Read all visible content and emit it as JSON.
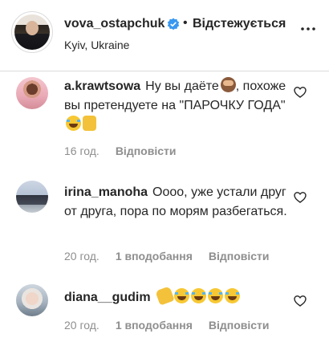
{
  "header": {
    "username": "vova_ostapchuk",
    "separator": "•",
    "follow_status": "Відстежується",
    "location": "Kyiv, Ukraine"
  },
  "comments": [
    {
      "username": "a.krawtsowa",
      "text_parts": [
        "Ну вы даёте",
        ", похоже вы претендуете на \"ПАРОЧКУ ГОДА\""
      ],
      "time": "16 год.",
      "likes": "",
      "reply": "Відповісти"
    },
    {
      "username": "irina_manoha",
      "text": "Оооо, уже устали друг от друга, пора по морям разбегаться.",
      "time": "20 год.",
      "likes": "1 вподобання",
      "reply": "Відповісти"
    },
    {
      "username": "diana__gudim",
      "text": "",
      "time": "20 год.",
      "likes": "1 вподобання",
      "reply": "Відповісти"
    }
  ],
  "icons": {
    "verified": "verified-badge-icon",
    "more": "more-options-icon",
    "heart": "heart-outline-icon"
  },
  "colors": {
    "text": "#262626",
    "secondary": "#8e8e8e",
    "verified": "#3897f0",
    "divider": "#dbdbdb"
  }
}
